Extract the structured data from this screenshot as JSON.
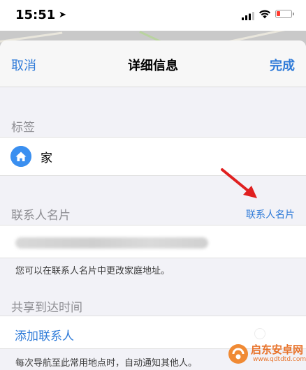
{
  "status_bar": {
    "time": "15:51",
    "location_arrow": "➤",
    "icons": [
      "cellular-signal-icon",
      "wifi-icon",
      "battery-low-icon"
    ],
    "battery_color": "#ff3b30"
  },
  "nav": {
    "cancel_label": "取消",
    "title": "详细信息",
    "done_label": "完成"
  },
  "label_section": {
    "header": "标签",
    "selected_label": "家",
    "icon": "house-icon"
  },
  "contact_card_section": {
    "header": "联系人名片",
    "link_label": "联系人名片",
    "footnote": "您可以在联系人名片中更改家庭地址。"
  },
  "share_eta_section": {
    "header": "共享到达时间",
    "add_contact_label": "添加联系人",
    "footnote": "每次导航至此常用地点时，自动通知其他人。"
  },
  "annotation": {
    "arrow_color": "#e02020"
  },
  "watermark": {
    "name": "启东安卓网",
    "url": "www.qdtdtd.com"
  },
  "colors": {
    "accent": "#2f7bd8",
    "background": "#f2f2f7",
    "home_icon": "#3a8ff0"
  }
}
